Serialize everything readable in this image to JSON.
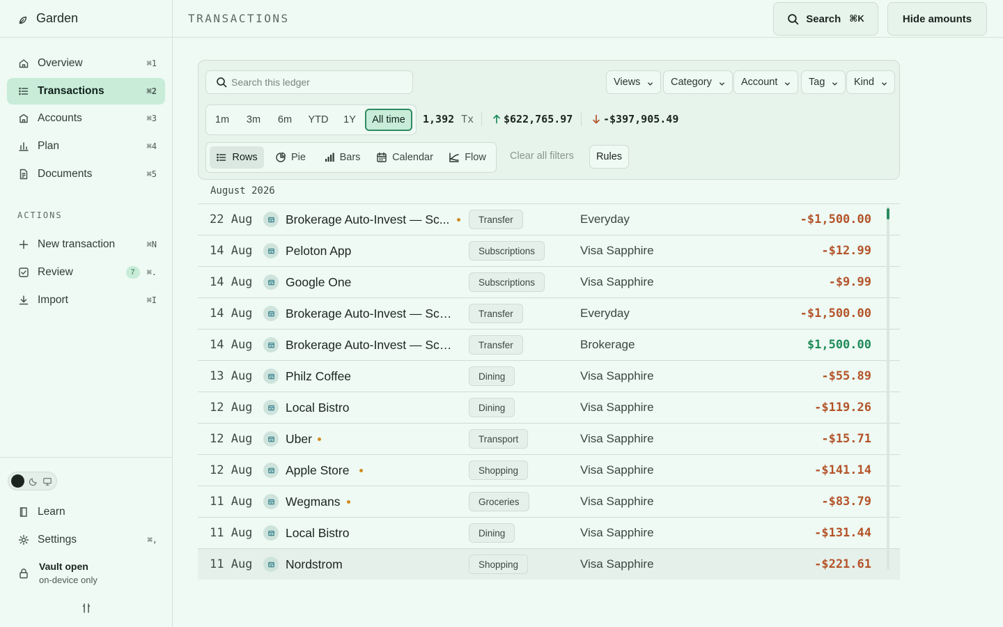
{
  "app": {
    "name": "Garden"
  },
  "sidebar": {
    "nav": [
      {
        "label": "Overview",
        "shortcut": "⌘1",
        "icon": "home-icon",
        "active": false
      },
      {
        "label": "Transactions",
        "shortcut": "⌘2",
        "icon": "list-icon",
        "active": true
      },
      {
        "label": "Accounts",
        "shortcut": "⌘3",
        "icon": "bank-icon",
        "active": false
      },
      {
        "label": "Plan",
        "shortcut": "⌘4",
        "icon": "bar-chart-icon",
        "active": false
      },
      {
        "label": "Documents",
        "shortcut": "⌘5",
        "icon": "document-icon",
        "active": false
      }
    ],
    "actions_title": "ACTIONS",
    "actions": [
      {
        "label": "New transaction",
        "shortcut": "⌘N",
        "icon": "plus-icon"
      },
      {
        "label": "Review",
        "badge": "7",
        "shortcut": "⌘.",
        "icon": "checkbox-icon"
      },
      {
        "label": "Import",
        "shortcut": "⌘I",
        "icon": "download-icon"
      }
    ],
    "bottom": {
      "learn": "Learn",
      "settings": "Settings",
      "settings_shortcut": "⌘,",
      "vault_title": "Vault open",
      "vault_subtitle": "on-device only"
    }
  },
  "topbar": {
    "title": "TRANSACTIONS",
    "search_label": "Search",
    "search_shortcut": "⌘K",
    "hide_amounts_label": "Hide amounts"
  },
  "filters": {
    "search_placeholder": "Search this ledger",
    "dropdowns": [
      "Views",
      "Category",
      "Account",
      "Tag",
      "Kind"
    ],
    "ranges": [
      "1m",
      "3m",
      "6m",
      "YTD",
      "1Y",
      "All time"
    ],
    "active_range": "All time",
    "tx_count": "1,392",
    "tx_unit": "Tx",
    "inflow": "$622,765.97",
    "outflow": "-$397,905.49",
    "views": [
      "Rows",
      "Pie",
      "Bars",
      "Calendar",
      "Flow"
    ],
    "active_view": "Rows",
    "clear_label": "Clear all filters",
    "rules_label": "Rules"
  },
  "ledger": {
    "month": "August 2026",
    "rows": [
      {
        "date": "22 Aug",
        "merchant": "Brokerage Auto-Invest — Sc...",
        "flag": true,
        "category": "Transfer",
        "account": "Everyday",
        "amount": "-$1,500.00",
        "sign": "neg"
      },
      {
        "date": "14 Aug",
        "merchant": "Peloton App",
        "flag": false,
        "category": "Subscriptions",
        "account": "Visa Sapphire",
        "amount": "-$12.99",
        "sign": "neg"
      },
      {
        "date": "14 Aug",
        "merchant": "Google One",
        "flag": false,
        "category": "Subscriptions",
        "account": "Visa Sapphire",
        "amount": "-$9.99",
        "sign": "neg"
      },
      {
        "date": "14 Aug",
        "merchant": "Brokerage Auto-Invest — Sch...",
        "flag": false,
        "category": "Transfer",
        "account": "Everyday",
        "amount": "-$1,500.00",
        "sign": "neg"
      },
      {
        "date": "14 Aug",
        "merchant": "Brokerage Auto-Invest — Sch...",
        "flag": false,
        "category": "Transfer",
        "account": "Brokerage",
        "amount": "$1,500.00",
        "sign": "pos"
      },
      {
        "date": "13 Aug",
        "merchant": "Philz Coffee",
        "flag": false,
        "category": "Dining",
        "account": "Visa Sapphire",
        "amount": "-$55.89",
        "sign": "neg"
      },
      {
        "date": "12 Aug",
        "merchant": "Local Bistro",
        "flag": false,
        "category": "Dining",
        "account": "Visa Sapphire",
        "amount": "-$119.26",
        "sign": "neg"
      },
      {
        "date": "12 Aug",
        "merchant": "Uber",
        "flag": true,
        "category": "Transport",
        "account": "Visa Sapphire",
        "amount": "-$15.71",
        "sign": "neg"
      },
      {
        "date": "12 Aug",
        "merchant": "Apple Store",
        "flag": true,
        "category": "Shopping",
        "account": "Visa Sapphire",
        "amount": "-$141.14",
        "sign": "neg"
      },
      {
        "date": "11 Aug",
        "merchant": "Wegmans",
        "flag": true,
        "category": "Groceries",
        "account": "Visa Sapphire",
        "amount": "-$83.79",
        "sign": "neg"
      },
      {
        "date": "11 Aug",
        "merchant": "Local Bistro",
        "flag": false,
        "category": "Dining",
        "account": "Visa Sapphire",
        "amount": "-$131.44",
        "sign": "neg"
      },
      {
        "date": "11 Aug",
        "merchant": "Nordstrom",
        "flag": false,
        "category": "Shopping",
        "account": "Visa Sapphire",
        "amount": "-$221.61",
        "sign": "neg"
      }
    ]
  },
  "colors": {
    "accent": "#2e8a61",
    "negative": "#b4532a",
    "positive": "#1f8a58",
    "flag": "#d08a1c"
  }
}
